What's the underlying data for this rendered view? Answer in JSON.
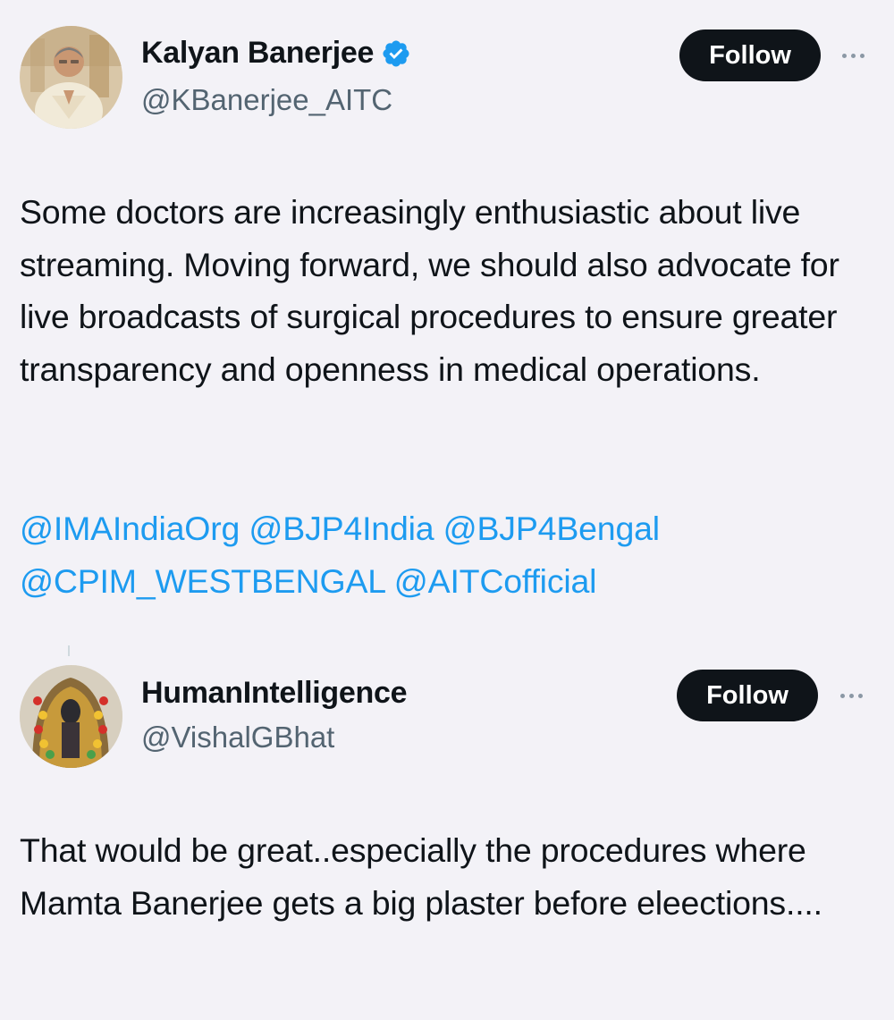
{
  "tweets": [
    {
      "display_name": "Kalyan Banerjee",
      "verified": true,
      "handle": "@KBanerjee_AITC",
      "follow_label": "Follow",
      "text": "Some doctors are increasingly enthusiastic about live streaming. Moving forward, we should also advocate for live broadcasts of surgical procedures to ensure greater transparency and openness in medical operations.",
      "mentions": [
        "@IMAIndiaOrg",
        "@BJP4India",
        "@BJP4Bengal",
        "@CPIM_WESTBENGAL",
        "@AITCofficial"
      ]
    },
    {
      "display_name": "HumanIntelligence",
      "verified": false,
      "handle": "@VishalGBhat",
      "follow_label": "Follow",
      "text": "That would be great..especially the procedures where Mamta Banerjee gets a big plaster before eleections...."
    }
  ],
  "colors": {
    "background": "#f3f2f7",
    "text": "#0f1419",
    "secondary_text": "#536471",
    "link": "#1d9bf0",
    "verified": "#1d9bf0",
    "follow_button_bg": "#0f1419"
  },
  "icons": {
    "verified": "verified-badge-icon",
    "more": "more-options-icon"
  }
}
